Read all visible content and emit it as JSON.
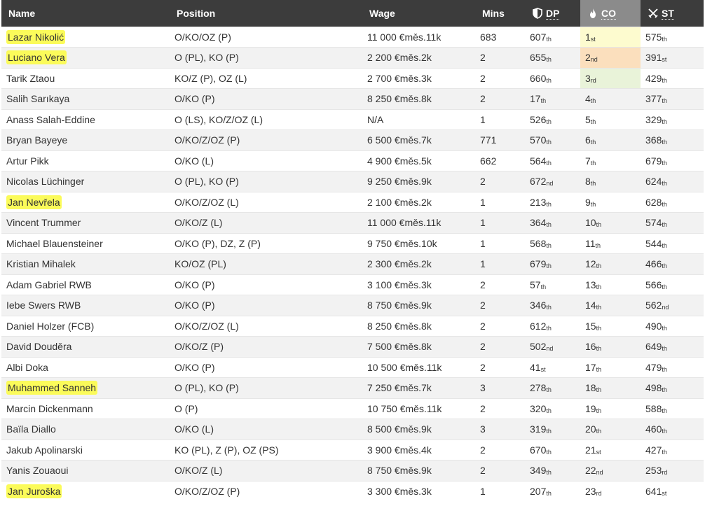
{
  "colors": {
    "header_bg": "#3c3c3c",
    "header_sorted_bg": "#8b8b8b",
    "highlight": "#fbfb5a",
    "rank1": "#fdfbcf",
    "rank2": "#fbdfbd",
    "rank3": "#e9f3d9"
  },
  "columns": {
    "name": "Name",
    "position": "Position",
    "wage": "Wage",
    "mins": "Mins",
    "dp": "DP",
    "co": "CO",
    "st": "ST",
    "dp_icon": "shield-icon",
    "co_icon": "flame-icon",
    "st_icon": "crossed-swords-icon"
  },
  "rows": [
    {
      "name": "Lazar Nikolić",
      "highlight": true,
      "position": "O/KO/OZ (P)",
      "wage": "11 000 €měs.11k",
      "mins": "683",
      "dp": "607",
      "dp_s": "th",
      "co": "1",
      "co_s": "st",
      "st": "575",
      "st_s": "th"
    },
    {
      "name": "Luciano Vera",
      "highlight": true,
      "position": "O (PL), KO (P)",
      "wage": "2 200 €měs.2k",
      "mins": "2",
      "dp": "655",
      "dp_s": "th",
      "co": "2",
      "co_s": "nd",
      "st": "391",
      "st_s": "st"
    },
    {
      "name": "Tarik Ztaou",
      "highlight": false,
      "position": "KO/Z (P), OZ (L)",
      "wage": "2 700 €měs.3k",
      "mins": "2",
      "dp": "660",
      "dp_s": "th",
      "co": "3",
      "co_s": "rd",
      "st": "429",
      "st_s": "th"
    },
    {
      "name": "Salih Sarıkaya",
      "highlight": false,
      "position": "O/KO (P)",
      "wage": "8 250 €měs.8k",
      "mins": "2",
      "dp": "17",
      "dp_s": "th",
      "co": "4",
      "co_s": "th",
      "st": "377",
      "st_s": "th"
    },
    {
      "name": "Anass Salah-Eddine",
      "highlight": false,
      "position": "O (LS), KO/Z/OZ (L)",
      "wage": "N/A",
      "mins": "1",
      "dp": "526",
      "dp_s": "th",
      "co": "5",
      "co_s": "th",
      "st": "329",
      "st_s": "th"
    },
    {
      "name": "Bryan Bayeye",
      "highlight": false,
      "position": "O/KO/Z/OZ (P)",
      "wage": "6 500 €měs.7k",
      "mins": "771",
      "dp": "570",
      "dp_s": "th",
      "co": "6",
      "co_s": "th",
      "st": "368",
      "st_s": "th"
    },
    {
      "name": "Artur Pikk",
      "highlight": false,
      "position": "O/KO (L)",
      "wage": "4 900 €měs.5k",
      "mins": "662",
      "dp": "564",
      "dp_s": "th",
      "co": "7",
      "co_s": "th",
      "st": "679",
      "st_s": "th"
    },
    {
      "name": "Nicolas Lüchinger",
      "highlight": false,
      "position": "O (PL), KO (P)",
      "wage": "9 250 €měs.9k",
      "mins": "2",
      "dp": "672",
      "dp_s": "nd",
      "co": "8",
      "co_s": "th",
      "st": "624",
      "st_s": "th"
    },
    {
      "name": "Jan Nevřela",
      "highlight": true,
      "position": "O/KO/Z/OZ (L)",
      "wage": "2 100 €měs.2k",
      "mins": "1",
      "dp": "213",
      "dp_s": "th",
      "co": "9",
      "co_s": "th",
      "st": "628",
      "st_s": "th"
    },
    {
      "name": "Vincent Trummer",
      "highlight": false,
      "position": "O/KO/Z (L)",
      "wage": "11 000 €měs.11k",
      "mins": "1",
      "dp": "364",
      "dp_s": "th",
      "co": "10",
      "co_s": "th",
      "st": "574",
      "st_s": "th"
    },
    {
      "name": "Michael Blauensteiner",
      "highlight": false,
      "position": "O/KO (P), DZ, Z (P)",
      "wage": "9 750 €měs.10k",
      "mins": "1",
      "dp": "568",
      "dp_s": "th",
      "co": "11",
      "co_s": "th",
      "st": "544",
      "st_s": "th"
    },
    {
      "name": "Kristian Mihalek",
      "highlight": false,
      "position": "KO/OZ (PL)",
      "wage": "2 300 €měs.2k",
      "mins": "1",
      "dp": "679",
      "dp_s": "th",
      "co": "12",
      "co_s": "th",
      "st": "466",
      "st_s": "th"
    },
    {
      "name": "Adam Gabriel RWB",
      "highlight": false,
      "position": "O/KO (P)",
      "wage": "3 100 €měs.3k",
      "mins": "2",
      "dp": "57",
      "dp_s": "th",
      "co": "13",
      "co_s": "th",
      "st": "566",
      "st_s": "th"
    },
    {
      "name": "Iebe Swers RWB",
      "highlight": false,
      "position": "O/KO (P)",
      "wage": "8 750 €měs.9k",
      "mins": "2",
      "dp": "346",
      "dp_s": "th",
      "co": "14",
      "co_s": "th",
      "st": "562",
      "st_s": "nd"
    },
    {
      "name": "Daniel Holzer (FCB)",
      "highlight": false,
      "position": "O/KO/Z/OZ (L)",
      "wage": "8 250 €měs.8k",
      "mins": "2",
      "dp": "612",
      "dp_s": "th",
      "co": "15",
      "co_s": "th",
      "st": "490",
      "st_s": "th"
    },
    {
      "name": "David Douděra",
      "highlight": false,
      "position": "O/KO/Z (P)",
      "wage": "7 500 €měs.8k",
      "mins": "2",
      "dp": "502",
      "dp_s": "nd",
      "co": "16",
      "co_s": "th",
      "st": "649",
      "st_s": "th"
    },
    {
      "name": "Albi Doka",
      "highlight": false,
      "position": "O/KO (P)",
      "wage": "10 500 €měs.11k",
      "mins": "2",
      "dp": "41",
      "dp_s": "st",
      "co": "17",
      "co_s": "th",
      "st": "479",
      "st_s": "th"
    },
    {
      "name": "Muhammed Sanneh",
      "highlight": true,
      "position": "O (PL), KO (P)",
      "wage": "7 250 €měs.7k",
      "mins": "3",
      "dp": "278",
      "dp_s": "th",
      "co": "18",
      "co_s": "th",
      "st": "498",
      "st_s": "th"
    },
    {
      "name": "Marcin Dickenmann",
      "highlight": false,
      "position": "O (P)",
      "wage": "10 750 €měs.11k",
      "mins": "2",
      "dp": "320",
      "dp_s": "th",
      "co": "19",
      "co_s": "th",
      "st": "588",
      "st_s": "th"
    },
    {
      "name": "Baïla Diallo",
      "highlight": false,
      "position": "O/KO (L)",
      "wage": "8 500 €měs.9k",
      "mins": "3",
      "dp": "319",
      "dp_s": "th",
      "co": "20",
      "co_s": "th",
      "st": "460",
      "st_s": "th"
    },
    {
      "name": "Jakub Apolinarski",
      "highlight": false,
      "position": "KO (PL), Z (P), OZ (PS)",
      "wage": "3 900 €měs.4k",
      "mins": "2",
      "dp": "670",
      "dp_s": "th",
      "co": "21",
      "co_s": "st",
      "st": "427",
      "st_s": "th"
    },
    {
      "name": "Yanis Zouaoui",
      "highlight": false,
      "position": "O/KO/Z (L)",
      "wage": "8 750 €měs.9k",
      "mins": "2",
      "dp": "349",
      "dp_s": "th",
      "co": "22",
      "co_s": "nd",
      "st": "253",
      "st_s": "rd"
    },
    {
      "name": "Jan Juroška",
      "highlight": true,
      "position": "O/KO/Z/OZ (P)",
      "wage": "3 300 €měs.3k",
      "mins": "1",
      "dp": "207",
      "dp_s": "th",
      "co": "23",
      "co_s": "rd",
      "st": "641",
      "st_s": "st"
    }
  ]
}
